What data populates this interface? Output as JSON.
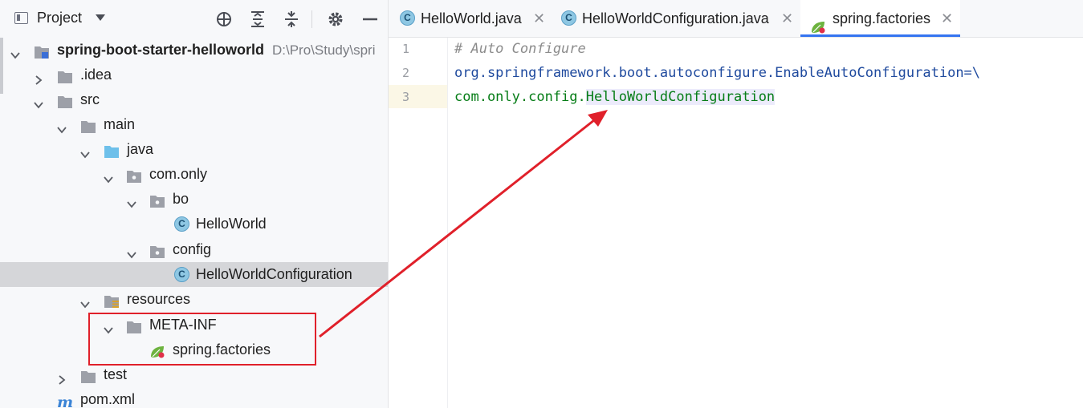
{
  "panel": {
    "title": "Project",
    "header_buttons": [
      "locate-icon",
      "expand-all-icon",
      "collapse-all-icon",
      "gear-icon",
      "minimize-icon"
    ]
  },
  "tree": {
    "root": {
      "label": "spring-boot-starter-helloworld",
      "path": "D:\\Pro\\Study\\spri"
    },
    "idea": ".idea",
    "src": "src",
    "main": "main",
    "java": "java",
    "package_com_only": "com.only",
    "package_bo": "bo",
    "class_helloworld": "HelloWorld",
    "package_config": "config",
    "class_helloworld_config": "HelloWorldConfiguration",
    "resources": "resources",
    "meta_inf": "META-INF",
    "spring_factories": "spring.factories",
    "test": "test",
    "pom": "pom.xml",
    "class_badge": "C"
  },
  "tabs": [
    {
      "label": "HelloWorld.java",
      "close": "✕",
      "badge": "C"
    },
    {
      "label": "HelloWorldConfiguration.java",
      "close": "✕",
      "badge": "C"
    },
    {
      "label": "spring.factories",
      "close": "✕"
    }
  ],
  "editor": {
    "line_numbers": [
      "1",
      "2",
      "3"
    ],
    "line1": "# Auto Configure",
    "line2": "org.springframework.boot.autoconfigure.EnableAutoConfiguration=\\",
    "line3_prefix": "com.only.config.",
    "line3_highlight": "HelloWorldConfiguration"
  },
  "colors": {
    "annotation_red": "#e0202a",
    "class_badge": "#8ec7e3",
    "active_tab_underline": "#3574f0",
    "selected_row": "#d5d6d9"
  }
}
